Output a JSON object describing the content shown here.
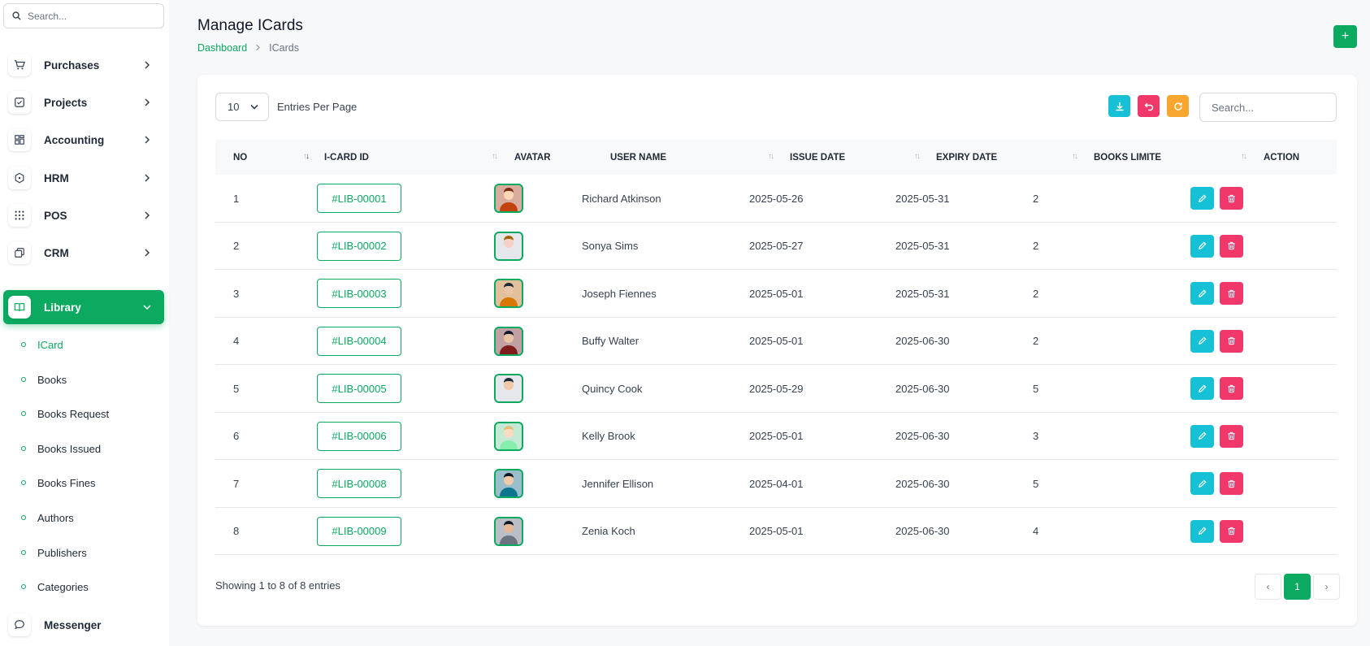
{
  "sidebar": {
    "search_placeholder": "Search...",
    "menu": [
      {
        "label": "Purchases",
        "icon": "cart-icon"
      },
      {
        "label": "Projects",
        "icon": "checkbox-icon"
      },
      {
        "label": "Accounting",
        "icon": "grid-icon"
      },
      {
        "label": "HRM",
        "icon": "cube-icon"
      },
      {
        "label": "POS",
        "icon": "dots-grid-icon"
      },
      {
        "label": "CRM",
        "icon": "copy-icon"
      },
      {
        "label": "Library",
        "icon": "book-icon",
        "active": true
      }
    ],
    "library_items": [
      "ICard",
      "Books",
      "Books Request",
      "Books Issued",
      "Books Fines",
      "Authors",
      "Publishers",
      "Categories"
    ],
    "messenger": "Messenger"
  },
  "header": {
    "title": "Manage ICards",
    "breadcrumb_root": "Dashboard",
    "breadcrumb_current": "ICards",
    "add_label": "+"
  },
  "controls": {
    "entries_value": "10",
    "entries_label": "Entries Per Page",
    "search_placeholder": "Search..."
  },
  "table": {
    "columns": [
      "NO",
      "I-CARD ID",
      "AVATAR",
      "USER NAME",
      "ISSUE DATE",
      "EXPIRY DATE",
      "BOOKS LIMITE",
      "ACTION"
    ],
    "rows": [
      {
        "no": "1",
        "id": "#LIB-00001",
        "name": "Richard Atkinson",
        "issue": "2025-05-26",
        "expiry": "2025-05-31",
        "limit": "2"
      },
      {
        "no": "2",
        "id": "#LIB-00002",
        "name": "Sonya Sims",
        "issue": "2025-05-27",
        "expiry": "2025-05-31",
        "limit": "2"
      },
      {
        "no": "3",
        "id": "#LIB-00003",
        "name": "Joseph Fiennes",
        "issue": "2025-05-01",
        "expiry": "2025-05-31",
        "limit": "2"
      },
      {
        "no": "4",
        "id": "#LIB-00004",
        "name": "Buffy Walter",
        "issue": "2025-05-01",
        "expiry": "2025-06-30",
        "limit": "2"
      },
      {
        "no": "5",
        "id": "#LIB-00005",
        "name": "Quincy Cook",
        "issue": "2025-05-29",
        "expiry": "2025-06-30",
        "limit": "5"
      },
      {
        "no": "6",
        "id": "#LIB-00006",
        "name": "Kelly Brook",
        "issue": "2025-05-01",
        "expiry": "2025-06-30",
        "limit": "3"
      },
      {
        "no": "7",
        "id": "#LIB-00008",
        "name": "Jennifer Ellison",
        "issue": "2025-04-01",
        "expiry": "2025-06-30",
        "limit": "5"
      },
      {
        "no": "8",
        "id": "#LIB-00009",
        "name": "Zenia Koch",
        "issue": "2025-05-01",
        "expiry": "2025-06-30",
        "limit": "4"
      }
    ]
  },
  "footer": {
    "showing": "Showing 1 to 8 of 8 entries",
    "current_page": "1",
    "prev": "‹",
    "next": "›"
  },
  "colors": {
    "accent": "#0ca960",
    "cyan": "#16c1d6",
    "pink": "#f0396a",
    "orange": "#f7a72f"
  }
}
